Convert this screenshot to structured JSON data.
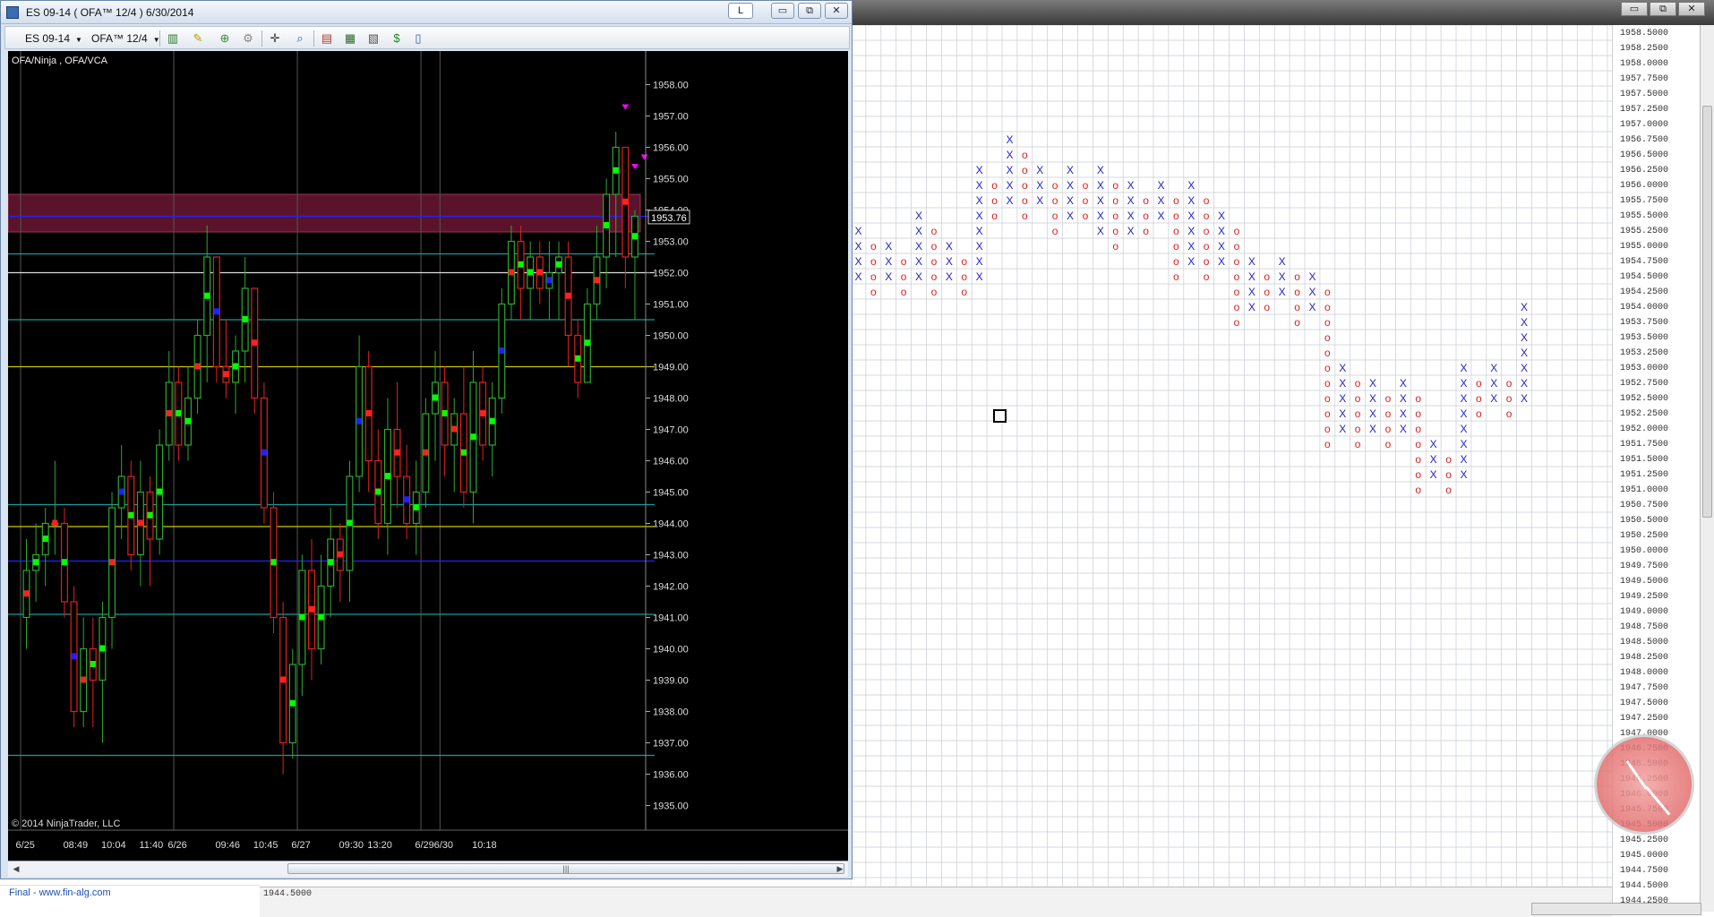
{
  "chart_window": {
    "title": "ES 09-14 ( OFA™ 12/4 )  6/30/2014",
    "lock_button": "L",
    "minimize_glyph": "▭",
    "restore_glyph": "⧉",
    "close_glyph": "✕"
  },
  "toolbar": {
    "instrument": "ES 09-14",
    "interval": "OFA™ 12/4",
    "icons": [
      "bar-style-icon",
      "pencil-icon",
      "add-indicator-icon",
      "strategy-icon",
      "crosshair-icon",
      "zoom-icon",
      "data-box-icon",
      "properties-icon",
      "chart-trader-icon",
      "dollar-icon",
      "list-icon"
    ]
  },
  "chart": {
    "indicator_label": "OFA/Ninja , OFA/VCA",
    "copyright": "© 2014 NinjaTrader, LLC",
    "price_marker": "1953.76",
    "colors": {
      "up": "#2ea82e",
      "down": "#e02020",
      "bid": "#00ff00",
      "ask": "#ff2020",
      "cyan": "#1a9a9a",
      "yellow": "#c8c800",
      "blue": "#2020ff",
      "magenta": "#ff00ff",
      "zone": "#7a1a3a"
    }
  },
  "chart_data": {
    "type": "candlestick",
    "title": "",
    "ylim": [
      1934.5,
      1958.5
    ],
    "y_ticks": [
      1958.0,
      1957.0,
      1956.0,
      1955.0,
      1954.0,
      1953.0,
      1952.0,
      1951.0,
      1950.0,
      1949.0,
      1948.0,
      1947.0,
      1946.0,
      1945.0,
      1944.0,
      1943.0,
      1942.0,
      1941.0,
      1940.0,
      1939.0,
      1938.0,
      1937.0,
      1936.0,
      1935.0
    ],
    "x_ticks": [
      {
        "label": "6/25",
        "bar": 0
      },
      {
        "label": "08:49",
        "bar": 5
      },
      {
        "label": "10:04",
        "bar": 9
      },
      {
        "label": "11:40",
        "bar": 13
      },
      {
        "label": "6/26",
        "bar": 16
      },
      {
        "label": "09:46",
        "bar": 21
      },
      {
        "label": "10:45",
        "bar": 25
      },
      {
        "label": "6/27",
        "bar": 29
      },
      {
        "label": "09:30",
        "bar": 34
      },
      {
        "label": "13:20",
        "bar": 37
      },
      {
        "label": "6/29",
        "bar": 42
      },
      {
        "label": "6/30",
        "bar": 44
      },
      {
        "label": "10:18",
        "bar": 48
      }
    ],
    "candles": [
      {
        "o": 1941.0,
        "h": 1943.5,
        "l": 1940.0,
        "c": 1942.5
      },
      {
        "o": 1942.5,
        "h": 1944.0,
        "l": 1941.5,
        "c": 1943.0
      },
      {
        "o": 1943.0,
        "h": 1944.5,
        "l": 1942.0,
        "c": 1944.0
      },
      {
        "o": 1944.0,
        "h": 1946.0,
        "l": 1943.0,
        "c": 1944.0
      },
      {
        "o": 1944.0,
        "h": 1944.5,
        "l": 1941.0,
        "c": 1941.5
      },
      {
        "o": 1941.5,
        "h": 1942.0,
        "l": 1937.5,
        "c": 1938.0
      },
      {
        "o": 1938.0,
        "h": 1941.0,
        "l": 1937.5,
        "c": 1940.0
      },
      {
        "o": 1940.0,
        "h": 1941.0,
        "l": 1937.5,
        "c": 1939.0
      },
      {
        "o": 1939.0,
        "h": 1941.5,
        "l": 1937.0,
        "c": 1941.0
      },
      {
        "o": 1941.0,
        "h": 1945.0,
        "l": 1940.0,
        "c": 1944.5
      },
      {
        "o": 1944.5,
        "h": 1946.5,
        "l": 1943.5,
        "c": 1945.5
      },
      {
        "o": 1945.5,
        "h": 1946.0,
        "l": 1942.5,
        "c": 1943.0
      },
      {
        "o": 1943.0,
        "h": 1946.0,
        "l": 1942.0,
        "c": 1945.0
      },
      {
        "o": 1945.0,
        "h": 1945.5,
        "l": 1942.0,
        "c": 1943.5
      },
      {
        "o": 1943.5,
        "h": 1947.0,
        "l": 1943.0,
        "c": 1946.5
      },
      {
        "o": 1946.5,
        "h": 1949.5,
        "l": 1946.0,
        "c": 1948.5
      },
      {
        "o": 1948.5,
        "h": 1949.0,
        "l": 1946.0,
        "c": 1946.5
      },
      {
        "o": 1946.5,
        "h": 1949.0,
        "l": 1946.0,
        "c": 1948.0
      },
      {
        "o": 1948.0,
        "h": 1950.5,
        "l": 1947.5,
        "c": 1950.0
      },
      {
        "o": 1950.0,
        "h": 1953.5,
        "l": 1948.5,
        "c": 1952.5
      },
      {
        "o": 1952.5,
        "h": 1952.5,
        "l": 1948.5,
        "c": 1949.0
      },
      {
        "o": 1949.0,
        "h": 1950.5,
        "l": 1948.0,
        "c": 1948.5
      },
      {
        "o": 1948.5,
        "h": 1950.0,
        "l": 1947.5,
        "c": 1949.5
      },
      {
        "o": 1949.5,
        "h": 1952.5,
        "l": 1948.5,
        "c": 1951.5
      },
      {
        "o": 1951.5,
        "h": 1951.5,
        "l": 1947.5,
        "c": 1948.0
      },
      {
        "o": 1948.0,
        "h": 1948.5,
        "l": 1944.0,
        "c": 1944.5
      },
      {
        "o": 1944.5,
        "h": 1945.0,
        "l": 1940.5,
        "c": 1941.0
      },
      {
        "o": 1941.0,
        "h": 1941.5,
        "l": 1936.0,
        "c": 1937.0
      },
      {
        "o": 1937.0,
        "h": 1940.0,
        "l": 1936.5,
        "c": 1939.5
      },
      {
        "o": 1939.5,
        "h": 1943.0,
        "l": 1938.5,
        "c": 1942.5
      },
      {
        "o": 1942.5,
        "h": 1943.5,
        "l": 1939.0,
        "c": 1940.0
      },
      {
        "o": 1940.0,
        "h": 1943.0,
        "l": 1939.5,
        "c": 1942.0
      },
      {
        "o": 1942.0,
        "h": 1944.5,
        "l": 1941.0,
        "c": 1943.5
      },
      {
        "o": 1943.5,
        "h": 1944.0,
        "l": 1941.5,
        "c": 1942.5
      },
      {
        "o": 1942.5,
        "h": 1946.0,
        "l": 1941.5,
        "c": 1945.5
      },
      {
        "o": 1945.5,
        "h": 1950.0,
        "l": 1945.0,
        "c": 1949.0
      },
      {
        "o": 1949.0,
        "h": 1949.5,
        "l": 1945.0,
        "c": 1946.0
      },
      {
        "o": 1946.0,
        "h": 1947.0,
        "l": 1943.5,
        "c": 1944.0
      },
      {
        "o": 1944.0,
        "h": 1948.0,
        "l": 1943.0,
        "c": 1947.0
      },
      {
        "o": 1947.0,
        "h": 1948.5,
        "l": 1944.5,
        "c": 1945.5
      },
      {
        "o": 1945.5,
        "h": 1946.5,
        "l": 1943.5,
        "c": 1944.0
      },
      {
        "o": 1944.0,
        "h": 1946.0,
        "l": 1943.0,
        "c": 1945.0
      },
      {
        "o": 1945.0,
        "h": 1948.0,
        "l": 1944.5,
        "c": 1947.5
      },
      {
        "o": 1947.5,
        "h": 1949.5,
        "l": 1946.0,
        "c": 1948.5
      },
      {
        "o": 1948.5,
        "h": 1949.0,
        "l": 1945.5,
        "c": 1946.5
      },
      {
        "o": 1946.5,
        "h": 1948.0,
        "l": 1945.0,
        "c": 1947.5
      },
      {
        "o": 1947.5,
        "h": 1949.0,
        "l": 1944.5,
        "c": 1945.0
      },
      {
        "o": 1945.0,
        "h": 1949.5,
        "l": 1944.0,
        "c": 1948.5
      },
      {
        "o": 1948.5,
        "h": 1949.0,
        "l": 1946.0,
        "c": 1946.5
      },
      {
        "o": 1946.5,
        "h": 1948.5,
        "l": 1945.5,
        "c": 1948.0
      },
      {
        "o": 1948.0,
        "h": 1951.5,
        "l": 1947.5,
        "c": 1951.0
      },
      {
        "o": 1951.0,
        "h": 1953.5,
        "l": 1950.5,
        "c": 1953.0
      },
      {
        "o": 1953.0,
        "h": 1953.5,
        "l": 1950.5,
        "c": 1951.5
      },
      {
        "o": 1951.5,
        "h": 1953.0,
        "l": 1950.5,
        "c": 1952.5
      },
      {
        "o": 1952.5,
        "h": 1953.0,
        "l": 1951.0,
        "c": 1951.5
      },
      {
        "o": 1951.5,
        "h": 1953.0,
        "l": 1950.5,
        "c": 1952.0
      },
      {
        "o": 1952.0,
        "h": 1953.0,
        "l": 1950.5,
        "c": 1952.5
      },
      {
        "o": 1952.5,
        "h": 1953.0,
        "l": 1949.0,
        "c": 1950.0
      },
      {
        "o": 1950.0,
        "h": 1950.5,
        "l": 1948.0,
        "c": 1948.5
      },
      {
        "o": 1948.5,
        "h": 1951.5,
        "l": 1948.5,
        "c": 1951.0
      },
      {
        "o": 1951.0,
        "h": 1953.5,
        "l": 1950.5,
        "c": 1952.5
      },
      {
        "o": 1952.5,
        "h": 1955.0,
        "l": 1951.5,
        "c": 1954.5
      },
      {
        "o": 1954.5,
        "h": 1956.5,
        "l": 1952.5,
        "c": 1956.0
      },
      {
        "o": 1956.0,
        "h": 1956.0,
        "l": 1951.5,
        "c": 1952.5
      },
      {
        "o": 1952.5,
        "h": 1954.0,
        "l": 1950.5,
        "c": 1953.8
      }
    ],
    "horizontal_levels": [
      {
        "price": 1953.8,
        "color": "blue"
      },
      {
        "price": 1952.6,
        "color": "cyan"
      },
      {
        "price": 1952.0,
        "color": "white"
      },
      {
        "price": 1950.5,
        "color": "cyan"
      },
      {
        "price": 1949.0,
        "color": "yellow"
      },
      {
        "price": 1944.6,
        "color": "cyan"
      },
      {
        "price": 1943.9,
        "color": "yellow"
      },
      {
        "price": 1942.8,
        "color": "blue"
      },
      {
        "price": 1941.1,
        "color": "cyan"
      },
      {
        "price": 1936.6,
        "color": "cyan"
      }
    ],
    "zone": {
      "from": 1953.3,
      "to": 1954.5
    }
  },
  "point_figure": {
    "box_size": 0.25,
    "top_price": 1958.5,
    "axis_labels": [
      "1958.5000",
      "1958.2500",
      "1958.0000",
      "1957.7500",
      "1957.5000",
      "1957.2500",
      "1957.0000",
      "1956.7500",
      "1956.5000",
      "1956.2500",
      "1956.0000",
      "1955.7500",
      "1955.5000",
      "1955.2500",
      "1955.0000",
      "1954.7500",
      "1954.5000",
      "1954.2500",
      "1954.0000",
      "1953.7500",
      "1953.5000",
      "1953.2500",
      "1953.0000",
      "1952.7500",
      "1952.5000",
      "1952.2500",
      "1952.0000",
      "1951.7500",
      "1951.5000",
      "1951.2500",
      "1951.0000",
      "1950.7500",
      "1950.5000",
      "1950.2500",
      "1950.0000",
      "1949.7500",
      "1949.5000",
      "1949.2500",
      "1949.0000",
      "1948.7500",
      "1948.5000",
      "1948.2500",
      "1948.0000",
      "1947.7500",
      "1947.5000",
      "1947.2500",
      "1947.0000",
      "1946.7500",
      "1946.5000",
      "1946.2500",
      "1946.0000",
      "1945.7500",
      "1945.5000",
      "1945.2500",
      "1945.0000",
      "1944.7500",
      "1944.5000",
      "1944.2500"
    ],
    "bottom_label": "1944.5000",
    "columns": [
      {
        "t": "X",
        "hi": 1955.25,
        "lo": 1954.5
      },
      {
        "t": "O",
        "hi": 1955.0,
        "lo": 1954.25
      },
      {
        "t": "X",
        "hi": 1955.0,
        "lo": 1954.5
      },
      {
        "t": "O",
        "hi": 1954.75,
        "lo": 1954.25
      },
      {
        "t": "X",
        "hi": 1955.5,
        "lo": 1954.5
      },
      {
        "t": "O",
        "hi": 1955.25,
        "lo": 1954.25
      },
      {
        "t": "X",
        "hi": 1955.0,
        "lo": 1954.5
      },
      {
        "t": "O",
        "hi": 1954.75,
        "lo": 1954.25
      },
      {
        "t": "X",
        "hi": 1956.25,
        "lo": 1954.5
      },
      {
        "t": "O",
        "hi": 1956.0,
        "lo": 1955.5
      },
      {
        "t": "X",
        "hi": 1956.75,
        "lo": 1955.75
      },
      {
        "t": "O",
        "hi": 1956.5,
        "lo": 1955.5
      },
      {
        "t": "X",
        "hi": 1956.25,
        "lo": 1955.75
      },
      {
        "t": "O",
        "hi": 1956.0,
        "lo": 1955.25
      },
      {
        "t": "X",
        "hi": 1956.25,
        "lo": 1955.5
      },
      {
        "t": "O",
        "hi": 1956.0,
        "lo": 1955.5
      },
      {
        "t": "X",
        "hi": 1956.25,
        "lo": 1955.25
      },
      {
        "t": "O",
        "hi": 1956.0,
        "lo": 1955.0
      },
      {
        "t": "X",
        "hi": 1956.0,
        "lo": 1955.25
      },
      {
        "t": "O",
        "hi": 1955.75,
        "lo": 1955.25
      },
      {
        "t": "X",
        "hi": 1956.0,
        "lo": 1955.5
      },
      {
        "t": "O",
        "hi": 1955.75,
        "lo": 1954.5
      },
      {
        "t": "X",
        "hi": 1956.0,
        "lo": 1954.75
      },
      {
        "t": "O",
        "hi": 1955.75,
        "lo": 1954.5
      },
      {
        "t": "X",
        "hi": 1955.5,
        "lo": 1954.75
      },
      {
        "t": "O",
        "hi": 1955.25,
        "lo": 1953.75
      },
      {
        "t": "X",
        "hi": 1954.75,
        "lo": 1954.0
      },
      {
        "t": "O",
        "hi": 1954.5,
        "lo": 1954.0
      },
      {
        "t": "X",
        "hi": 1954.75,
        "lo": 1954.25
      },
      {
        "t": "O",
        "hi": 1954.5,
        "lo": 1953.75
      },
      {
        "t": "X",
        "hi": 1954.5,
        "lo": 1954.0
      },
      {
        "t": "O",
        "hi": 1954.25,
        "lo": 1951.75
      },
      {
        "t": "X",
        "hi": 1953.0,
        "lo": 1952.0
      },
      {
        "t": "O",
        "hi": 1952.75,
        "lo": 1951.75
      },
      {
        "t": "X",
        "hi": 1952.75,
        "lo": 1952.0
      },
      {
        "t": "O",
        "hi": 1952.5,
        "lo": 1951.75
      },
      {
        "t": "X",
        "hi": 1952.75,
        "lo": 1952.0
      },
      {
        "t": "O",
        "hi": 1952.5,
        "lo": 1951.0
      },
      {
        "t": "X",
        "hi": 1951.75,
        "lo": 1951.25
      },
      {
        "t": "O",
        "hi": 1951.5,
        "lo": 1951.0
      },
      {
        "t": "X",
        "hi": 1953.0,
        "lo": 1951.25
      },
      {
        "t": "O",
        "hi": 1952.75,
        "lo": 1952.25
      },
      {
        "t": "X",
        "hi": 1953.0,
        "lo": 1952.5
      },
      {
        "t": "O",
        "hi": 1952.75,
        "lo": 1952.25
      },
      {
        "t": "X",
        "hi": 1954.0,
        "lo": 1952.5
      }
    ],
    "colors": {
      "x": "#2323c8",
      "o": "#e02020",
      "grid": "#c9ccd4"
    }
  },
  "clock": {
    "labels": [
      "1947.0000",
      "1946.7500",
      "1946.5000",
      "1946.2500",
      "1946.0000",
      "1945.7500",
      "1945.5000"
    ]
  },
  "status": {
    "link_text": "Final - www.fin-alg.com"
  },
  "background": {
    "min_glyph": "▭",
    "max_glyph": "⧉",
    "close_glyph": "✕"
  }
}
